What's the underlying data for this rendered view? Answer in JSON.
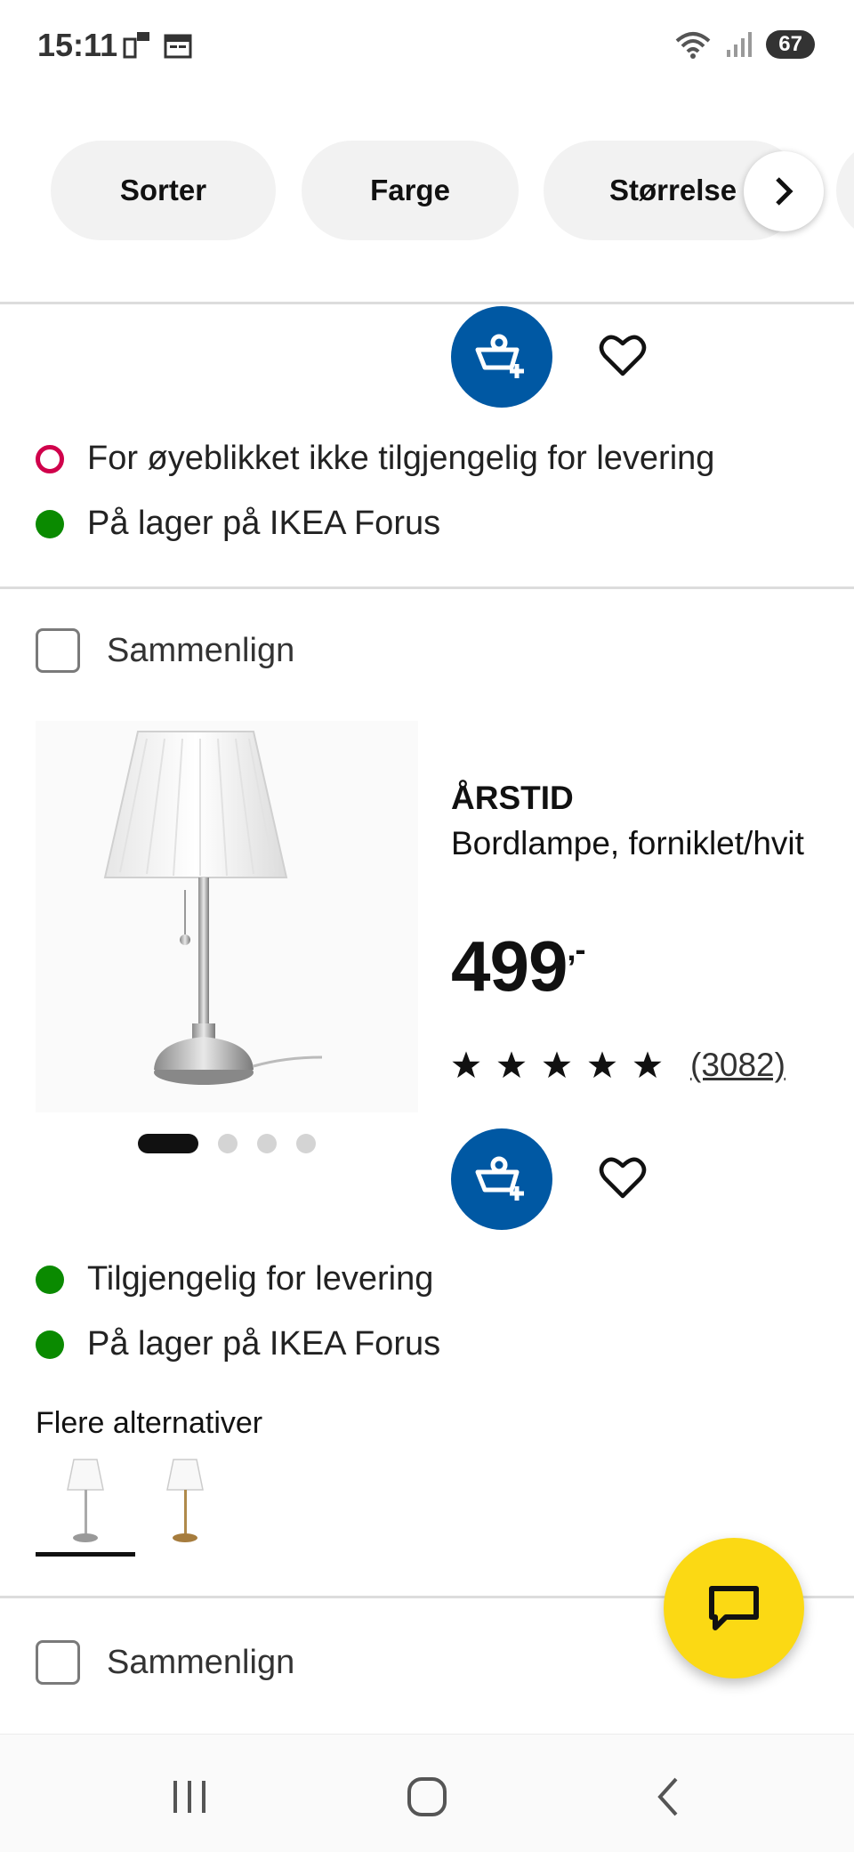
{
  "status_bar": {
    "time": "15:11",
    "battery": "67",
    "icons": [
      "notification-icon",
      "calendar-icon",
      "wifi-icon",
      "signal-icon"
    ]
  },
  "filters": {
    "chips": [
      "Sorter",
      "Farge",
      "Størrelse"
    ],
    "next_icon": "chevron-right-icon"
  },
  "previous_product": {
    "availability": [
      {
        "status": "unavailable",
        "text": "For øyeblikket ikke tilgjengelig for levering"
      },
      {
        "status": "available",
        "text": "På lager på IKEA Forus"
      }
    ]
  },
  "product": {
    "compare_label": "Sammenlign",
    "name": "ÅRSTID",
    "description": "Bordlampe, forniklet/hvit",
    "price": "499",
    "price_suffix": ",-",
    "rating": 5,
    "review_count": "(3082)",
    "image_pages": 4,
    "active_page": 0,
    "availability": [
      {
        "status": "available",
        "text": "Tilgjengelig for levering"
      },
      {
        "status": "available",
        "text": "På lager på IKEA Forus"
      }
    ],
    "more_options_label": "Flere alternativer",
    "variants": [
      "nickel-white",
      "brass-white"
    ]
  },
  "next_product": {
    "compare_label": "Sammenlign"
  },
  "colors": {
    "ikea_blue": "#0058a3",
    "chat_yellow": "#fbd914",
    "available_green": "#0a8a00",
    "unavailable_red": "#d0004b"
  }
}
